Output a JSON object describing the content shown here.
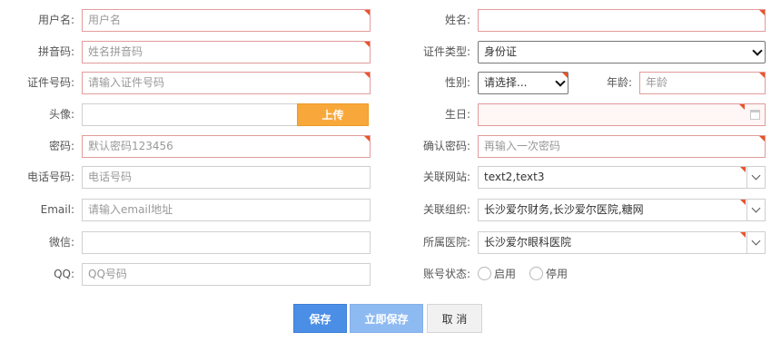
{
  "left": {
    "username": {
      "label": "用户名:",
      "placeholder": "用户名"
    },
    "pinyin": {
      "label": "拼音码:",
      "placeholder": "姓名拼音码"
    },
    "id_number": {
      "label": "证件号码:",
      "placeholder": "请输入证件号码"
    },
    "avatar": {
      "label": "头像:",
      "upload_label": "上传"
    },
    "password": {
      "label": "密码:",
      "value": "默认密码123456"
    },
    "phone": {
      "label": "电话号码:",
      "placeholder": "电话号码"
    },
    "email": {
      "label": "Email:",
      "placeholder": "请输入email地址"
    },
    "wechat": {
      "label": "微信:",
      "value": ""
    },
    "qq": {
      "label": "QQ:",
      "placeholder": "QQ号码"
    }
  },
  "right": {
    "name": {
      "label": "姓名:",
      "value": ""
    },
    "id_type": {
      "label": "证件类型:",
      "value": "身份证"
    },
    "gender": {
      "label": "性别:",
      "value": "请选择..."
    },
    "age": {
      "label": "年龄:",
      "placeholder": "年龄"
    },
    "birthday": {
      "label": "生日:",
      "value": ""
    },
    "confirm_password": {
      "label": "确认密码:",
      "placeholder": "再输入一次密码"
    },
    "websites": {
      "label": "关联网站:",
      "value": "text2,text3"
    },
    "organizations": {
      "label": "关联组织:",
      "value": "长沙爱尔财务,长沙爱尔医院,糖网"
    },
    "hospital": {
      "label": "所属医院:",
      "value": "长沙爱尔眼科医院"
    },
    "account_status": {
      "label": "账号状态:",
      "options": [
        "启用",
        "停用"
      ]
    }
  },
  "buttons": {
    "save": "保存",
    "save_now": "立即保存",
    "cancel": "取 消"
  }
}
